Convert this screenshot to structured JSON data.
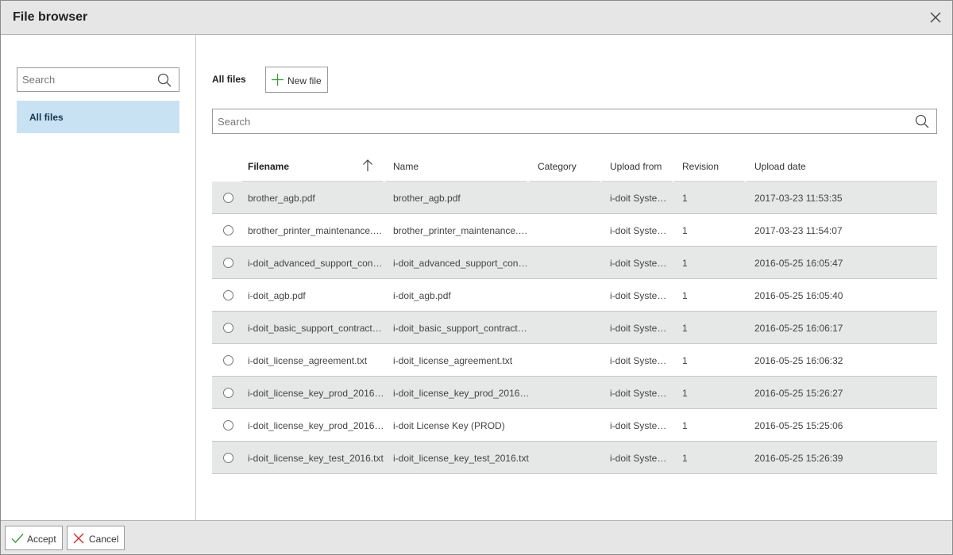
{
  "dialog": {
    "title": "File browser",
    "close_icon": "close-icon"
  },
  "sidebar": {
    "search_placeholder": "Search",
    "items": [
      {
        "label": "All files",
        "selected": true
      }
    ]
  },
  "main": {
    "title": "All files",
    "new_file_label": "New file",
    "search_placeholder": "Search"
  },
  "table": {
    "sort": {
      "column": "Filename",
      "direction": "ascending"
    },
    "columns": {
      "filename": "Filename",
      "name": "Name",
      "category": "Category",
      "upload_from": "Upload from",
      "revision": "Revision",
      "upload_date": "Upload date"
    },
    "rows": [
      {
        "filename": "brother_agb.pdf",
        "name": "brother_agb.pdf",
        "category": "",
        "upload_from": "i-doit Syste…",
        "revision": "1",
        "upload_date": "2017-03-23 11:53:35"
      },
      {
        "filename": "brother_printer_maintenance.…",
        "name": "brother_printer_maintenance.…",
        "category": "",
        "upload_from": "i-doit Syste…",
        "revision": "1",
        "upload_date": "2017-03-23 11:54:07"
      },
      {
        "filename": "i-doit_advanced_support_con…",
        "name": "i-doit_advanced_support_con…",
        "category": "",
        "upload_from": "i-doit Syste…",
        "revision": "1",
        "upload_date": "2016-05-25 16:05:47"
      },
      {
        "filename": "i-doit_agb.pdf",
        "name": "i-doit_agb.pdf",
        "category": "",
        "upload_from": "i-doit Syste…",
        "revision": "1",
        "upload_date": "2016-05-25 16:05:40"
      },
      {
        "filename": "i-doit_basic_support_contract.…",
        "name": "i-doit_basic_support_contract.…",
        "category": "",
        "upload_from": "i-doit Syste…",
        "revision": "1",
        "upload_date": "2016-05-25 16:06:17"
      },
      {
        "filename": "i-doit_license_agreement.txt",
        "name": "i-doit_license_agreement.txt",
        "category": "",
        "upload_from": "i-doit Syste…",
        "revision": "1",
        "upload_date": "2016-05-25 16:06:32"
      },
      {
        "filename": "i-doit_license_key_prod_2016…",
        "name": "i-doit_license_key_prod_2016…",
        "category": "",
        "upload_from": "i-doit Syste…",
        "revision": "1",
        "upload_date": "2016-05-25 15:26:27"
      },
      {
        "filename": "i-doit_license_key_prod_2016…",
        "name": "i-doit License Key (PROD)",
        "category": "",
        "upload_from": "i-doit Syste…",
        "revision": "1",
        "upload_date": "2016-05-25 15:25:06"
      },
      {
        "filename": "i-doit_license_key_test_2016.txt",
        "name": "i-doit_license_key_test_2016.txt",
        "category": "",
        "upload_from": "i-doit Syste…",
        "revision": "1",
        "upload_date": "2016-05-25 15:26:39"
      }
    ]
  },
  "footer": {
    "accept_label": "Accept",
    "cancel_label": "Cancel"
  },
  "colors": {
    "accept_check": "#3a9a3a",
    "cancel_x": "#d03030",
    "new_file_plus": "#3a9a3a",
    "selected_sidebar_bg": "#c9e2f3",
    "row_alt_bg": "#e6e7e7"
  }
}
